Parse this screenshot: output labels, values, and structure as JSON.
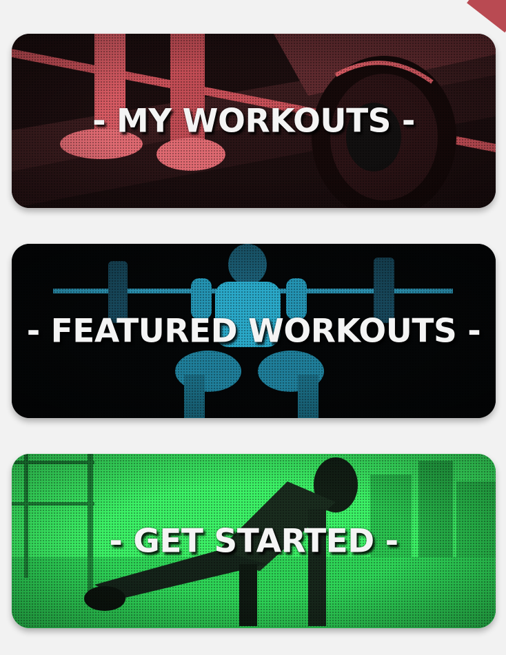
{
  "cards": [
    {
      "title": "- MY WORKOUTS -",
      "tint": "#e0575f",
      "base": "#1a0d0e"
    },
    {
      "title": "- FEATURED WORKOUTS -",
      "tint": "#2aa9c9",
      "base": "#050708"
    },
    {
      "title": "- GET STARTED -",
      "tint": "#36f060",
      "base": "#2ee85a"
    }
  ],
  "accent": "#b94a52"
}
